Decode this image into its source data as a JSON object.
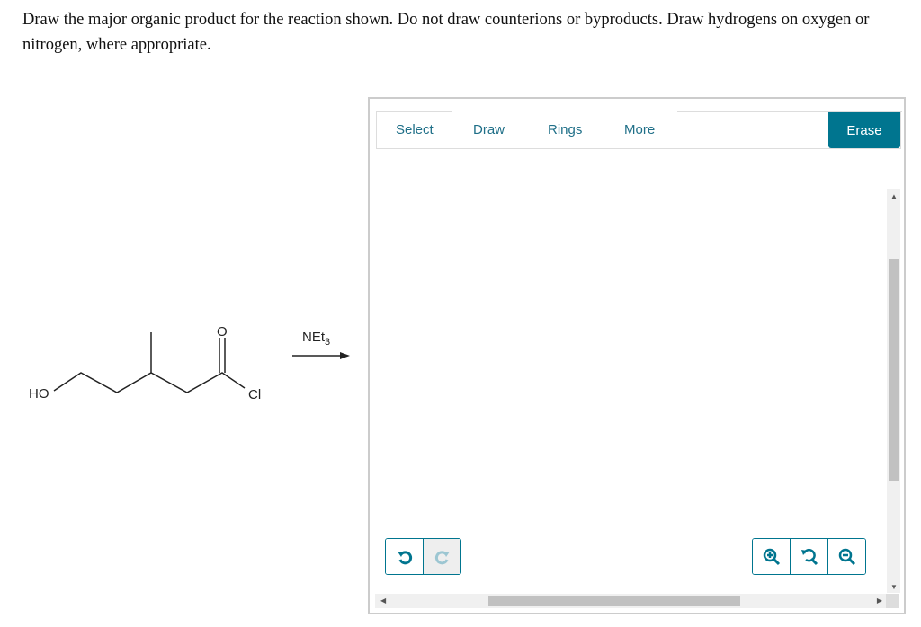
{
  "question": "Draw the major organic product for the reaction shown. Do not draw counterions or byproducts. Draw hydrogens on oxygen or nitrogen, where appropriate.",
  "reaction": {
    "reactant_labels": {
      "ho": "HO",
      "o": "O",
      "cl": "Cl"
    },
    "reagent": "NEt",
    "reagent_sub": "3"
  },
  "editor": {
    "tabs": [
      "Select",
      "Draw",
      "Rings",
      "More"
    ],
    "erase_label": "Erase",
    "undo_icon": "undo-icon",
    "redo_icon": "redo-icon",
    "redo_disabled": true,
    "zoom_in_icon": "zoom-in-icon",
    "zoom_reset_icon": "zoom-reset-icon",
    "zoom_out_icon": "zoom-out-icon",
    "accent": "#00758f"
  }
}
